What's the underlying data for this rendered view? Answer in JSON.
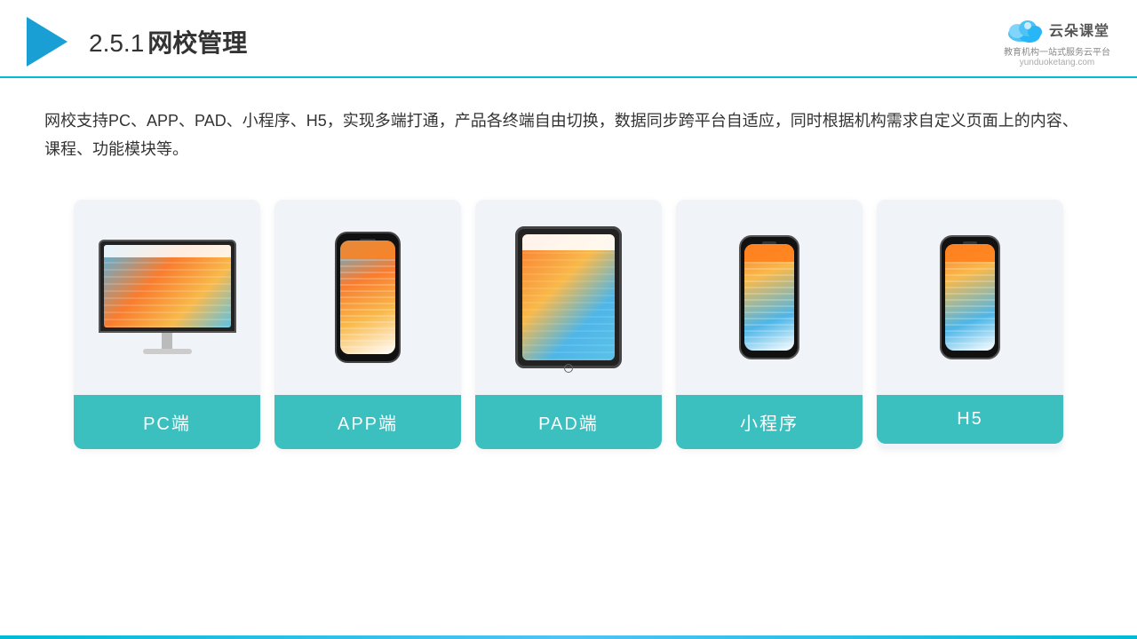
{
  "header": {
    "section_number": "2.5.1",
    "title": "网校管理",
    "logo_name": "云朵课堂",
    "logo_url": "yunduoketang.com",
    "logo_tagline": "教育机构一站\n式服务云平台"
  },
  "description": {
    "text": "网校支持PC、APP、PAD、小程序、H5，实现多端打通，产品各终端自由切换，数据同步跨平台自适应，同时根据机构需求自定义页面上的内容、课程、功能模块等。"
  },
  "cards": [
    {
      "id": "pc",
      "label": "PC端"
    },
    {
      "id": "app",
      "label": "APP端"
    },
    {
      "id": "pad",
      "label": "PAD端"
    },
    {
      "id": "miniprogram",
      "label": "小程序"
    },
    {
      "id": "h5",
      "label": "H5"
    }
  ],
  "colors": {
    "accent": "#00bcd4",
    "card_label_bg": "#3bbfbf",
    "header_border": "#00bcd4"
  }
}
